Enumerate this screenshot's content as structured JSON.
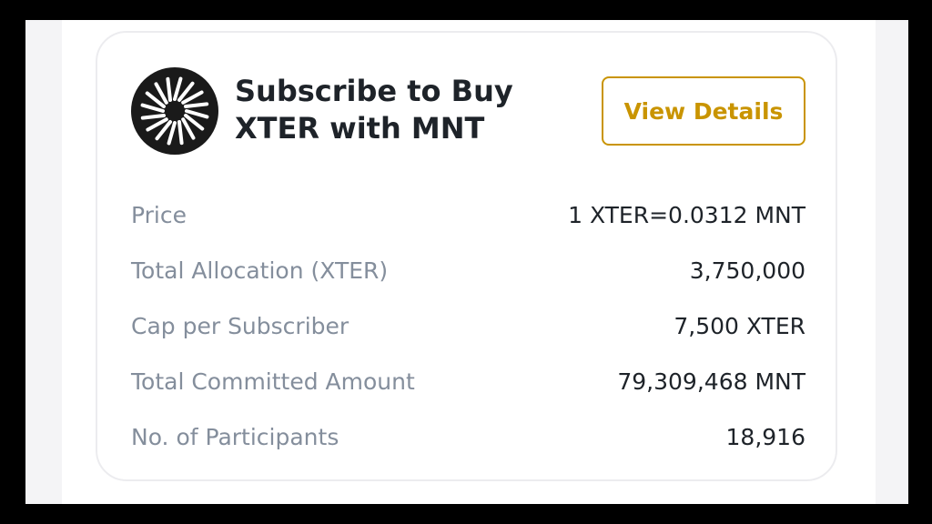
{
  "card": {
    "title_line1": "Subscribe to Buy",
    "title_line2": "XTER with MNT",
    "logo_icon": "xter-logo-icon",
    "view_details_label": "View Details",
    "accent_color": "#c99400"
  },
  "stats": [
    {
      "label": "Price",
      "value": "1 XTER=0.0312 MNT"
    },
    {
      "label": "Total Allocation (XTER)",
      "value": "3,750,000"
    },
    {
      "label": "Cap per Subscriber",
      "value": "7,500 XTER"
    },
    {
      "label": "Total Committed Amount",
      "value": "79,309,468 MNT"
    },
    {
      "label": "No. of Participants",
      "value": "18,916"
    }
  ]
}
